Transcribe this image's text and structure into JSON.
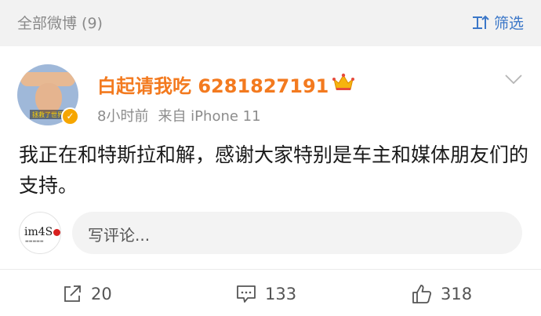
{
  "topbar": {
    "all_posts_label": "全部微博 (9)",
    "filter_label": "筛选"
  },
  "post": {
    "username": "白起请我吃 6281827191",
    "time": "8小时前",
    "source": "来自 iPhone 11",
    "content": "我正在和特斯拉和解，感谢大家特别是车主和媒体朋友们的支持。",
    "avatar_caption": "拯救了世界",
    "verified_icon": "verified-badge-icon",
    "vip_icon": "crown-icon"
  },
  "comment_bar": {
    "commenter_logo": "im4S",
    "placeholder": "写评论..."
  },
  "actions": {
    "repost_count": "20",
    "comment_count": "133",
    "like_count": "318"
  },
  "colors": {
    "username": "#f37a1f",
    "link_blue": "#3b77c8",
    "topbar_bg": "#f2f2f2"
  }
}
